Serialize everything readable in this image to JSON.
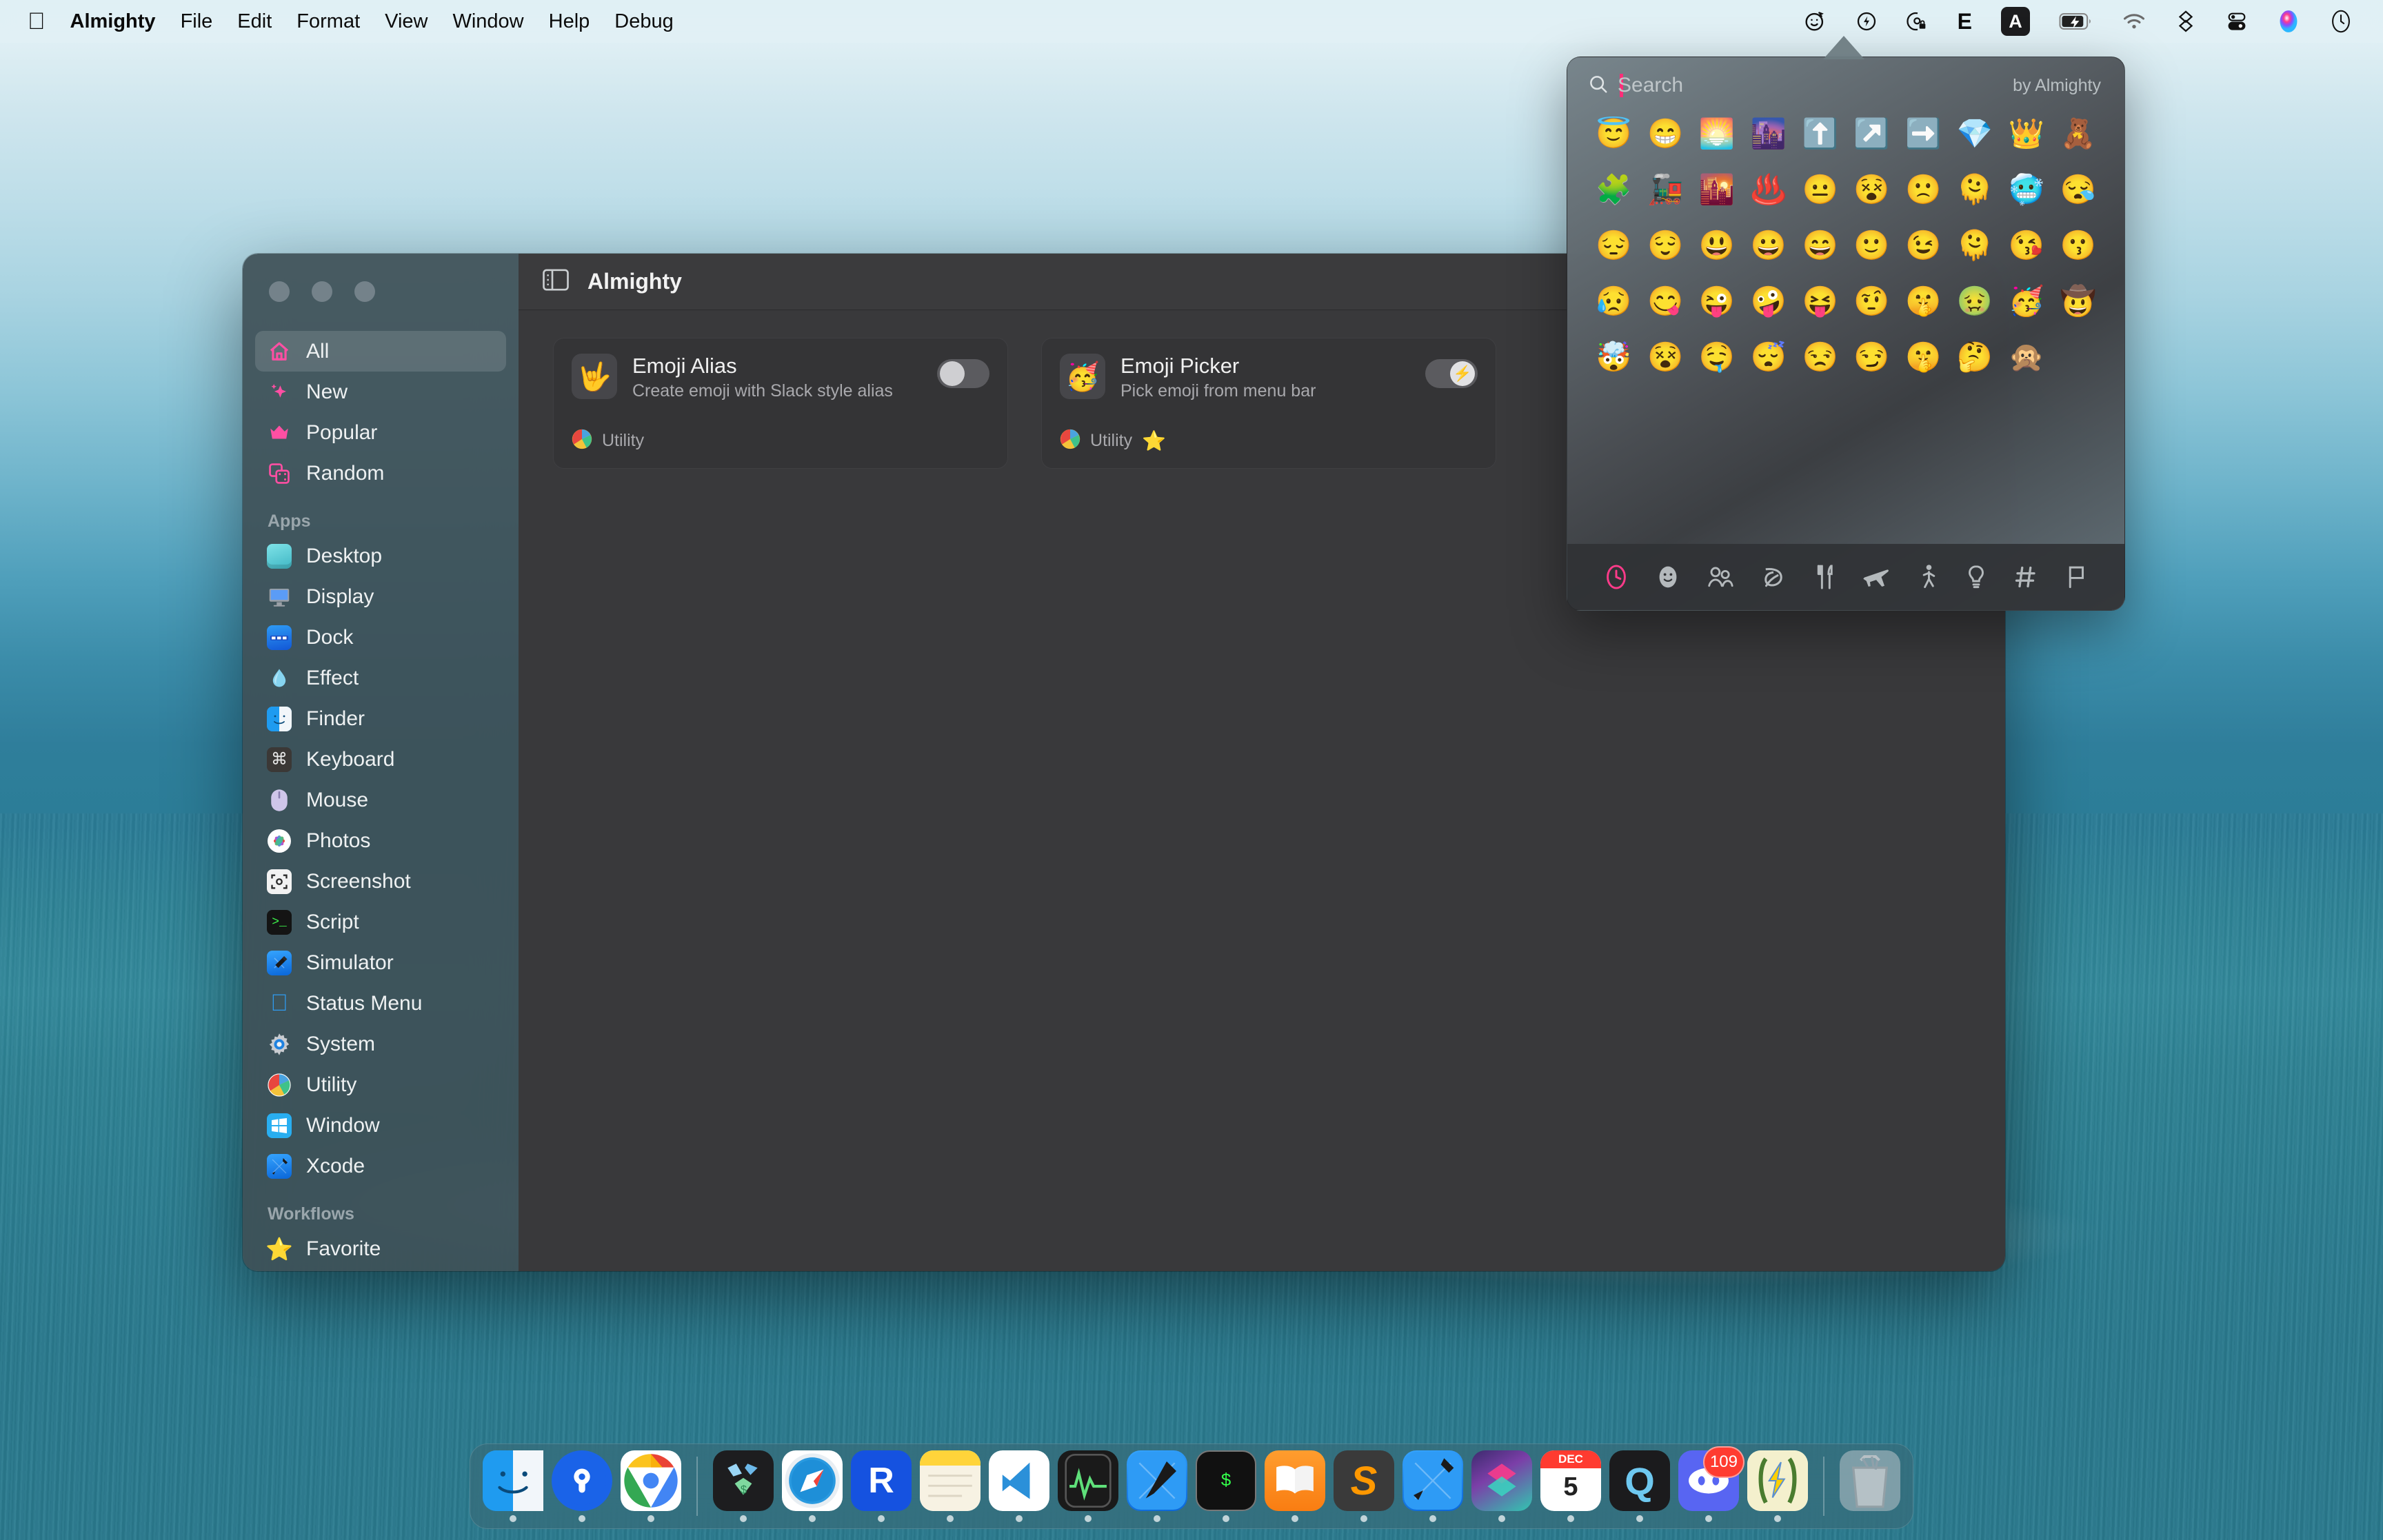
{
  "menubar": {
    "apple_icon": "apple-icon",
    "items": [
      {
        "label": "Almighty",
        "bold": true
      },
      {
        "label": "File",
        "bold": false
      },
      {
        "label": "Edit",
        "bold": false
      },
      {
        "label": "Format",
        "bold": false
      },
      {
        "label": "View",
        "bold": false
      },
      {
        "label": "Window",
        "bold": false
      },
      {
        "label": "Help",
        "bold": false
      },
      {
        "label": "Debug",
        "bold": false
      }
    ],
    "status_icons": [
      "emoji-smiley-icon",
      "bolt-circle-icon",
      "lock-circle-icon",
      "letter-e-icon",
      "input-source-a-icon",
      "battery-charging-icon",
      "wifi-icon",
      "dropbox-icon",
      "control-center-icon",
      "siri-icon",
      "clock-icon"
    ],
    "status_text": {
      "e_label": "E",
      "a_label": "A"
    }
  },
  "window": {
    "toolbar": {
      "sidebar_toggle_icon": "sidebar-toggle-icon",
      "title": "Almighty",
      "search_icon": "search-icon"
    },
    "sidebar": {
      "top_items": [
        {
          "label": "All",
          "icon": "home-icon",
          "glyph": "⌂",
          "active": true
        },
        {
          "label": "New",
          "icon": "sparkles-icon",
          "glyph": "✦",
          "active": false
        },
        {
          "label": "Popular",
          "icon": "crown-icon",
          "glyph": "♛",
          "active": false
        },
        {
          "label": "Random",
          "icon": "dice-icon",
          "glyph": "⚇",
          "active": false
        }
      ],
      "apps_header": "Apps",
      "apps": [
        {
          "label": "Desktop",
          "icon": "desktop-icon"
        },
        {
          "label": "Display",
          "icon": "display-icon"
        },
        {
          "label": "Dock",
          "icon": "dock-icon"
        },
        {
          "label": "Effect",
          "icon": "water-drop-icon"
        },
        {
          "label": "Finder",
          "icon": "finder-icon"
        },
        {
          "label": "Keyboard",
          "icon": "command-key-icon"
        },
        {
          "label": "Mouse",
          "icon": "mouse-icon"
        },
        {
          "label": "Photos",
          "icon": "photos-icon"
        },
        {
          "label": "Screenshot",
          "icon": "screenshot-icon"
        },
        {
          "label": "Script",
          "icon": "terminal-script-icon"
        },
        {
          "label": "Simulator",
          "icon": "simulator-icon"
        },
        {
          "label": "Status Menu",
          "icon": "apple-logo-icon"
        },
        {
          "label": "System",
          "icon": "gear-icon"
        },
        {
          "label": "Utility",
          "icon": "beach-ball-icon"
        },
        {
          "label": "Window",
          "icon": "windows-logo-icon"
        },
        {
          "label": "Xcode",
          "icon": "xcode-hammer-icon"
        }
      ],
      "workflows_header": "Workflows",
      "workflows": [
        {
          "label": "Favorite",
          "icon": "star-icon",
          "glyph": "⭐"
        }
      ]
    },
    "cards": [
      {
        "icon": "love-you-gesture-icon",
        "glyph": "🤟",
        "title": "Emoji Alias",
        "subtitle": "Create emoji with Slack style alias",
        "toggle_on": false,
        "toggle_glyph": "",
        "category": "Utility",
        "category_icon": "beach-ball-icon",
        "favorite": false,
        "favorite_glyph": ""
      },
      {
        "icon": "partying-face-icon",
        "glyph": "🥳",
        "title": "Emoji Picker",
        "subtitle": "Pick emoji from menu bar",
        "toggle_on": true,
        "toggle_glyph": "⚡",
        "category": "Utility",
        "category_icon": "beach-ball-icon",
        "favorite": true,
        "favorite_glyph": "⭐"
      }
    ]
  },
  "emoji_popup": {
    "search_icon": "search-icon",
    "search_value": "",
    "search_placeholder": "Search",
    "branding": "by Almighty",
    "caret_color": "#ff2d78",
    "accent_color": "#ff3b8a",
    "emojis": [
      "😇",
      "😁",
      "🌅",
      "🌆",
      "⬆️",
      "↗️",
      "➡️",
      "💎",
      "👑",
      "🧸",
      "🧩",
      "🚂",
      "🌇",
      "♨️",
      "😐",
      "😵",
      "🙁",
      "🫠",
      "🥶",
      "😪",
      "😔",
      "😌",
      "😃",
      "😀",
      "😄",
      "🙂",
      "😉",
      "🫠",
      "😘",
      "😗",
      "😥",
      "😋",
      "😜",
      "🤪",
      "😝",
      "🤨",
      "🤫",
      "🤢",
      "🥳",
      "🤠",
      "🤯",
      "😵",
      "🤤",
      "😴",
      "😒",
      "😏",
      "🤫",
      "🤔",
      "🙊"
    ],
    "categories": [
      {
        "name": "recent-clock-icon",
        "active": true
      },
      {
        "name": "smileys-icon",
        "active": false
      },
      {
        "name": "people-icon",
        "active": false
      },
      {
        "name": "nature-leaf-icon",
        "active": false
      },
      {
        "name": "food-icon",
        "active": false
      },
      {
        "name": "travel-plane-icon",
        "active": false
      },
      {
        "name": "activity-walk-icon",
        "active": false
      },
      {
        "name": "objects-bulb-icon",
        "active": false
      },
      {
        "name": "symbols-hash-icon",
        "active": false
      },
      {
        "name": "flags-icon",
        "active": false
      }
    ]
  },
  "dock": {
    "left_apps": [
      {
        "name": "finder",
        "label": "Finder",
        "glyph": "",
        "running": true
      },
      {
        "name": "1password",
        "label": "1Password",
        "glyph": "",
        "running": true
      },
      {
        "name": "chrome",
        "label": "Google Chrome",
        "glyph": "",
        "running": true
      }
    ],
    "main_apps": [
      {
        "name": "sketch",
        "label": "Sketch",
        "glyph": "",
        "running": true
      },
      {
        "name": "safari",
        "label": "Safari",
        "glyph": "",
        "running": true
      },
      {
        "name": "rectangle",
        "label": "Rectangle",
        "glyph": "R",
        "running": true
      },
      {
        "name": "notes",
        "label": "Notes",
        "glyph": "",
        "running": true
      },
      {
        "name": "vscode",
        "label": "Visual Studio Code",
        "glyph": "",
        "running": true
      },
      {
        "name": "activity-monitor",
        "label": "Activity Monitor",
        "glyph": "",
        "running": true
      },
      {
        "name": "xcode-beta",
        "label": "Xcode Beta",
        "glyph": "",
        "running": true
      },
      {
        "name": "terminal",
        "label": "Terminal",
        "glyph": "$",
        "running": true
      },
      {
        "name": "books",
        "label": "Books",
        "glyph": "",
        "running": true
      },
      {
        "name": "sublime",
        "label": "Sublime Text",
        "glyph": "S",
        "running": true
      },
      {
        "name": "xcode",
        "label": "Xcode",
        "glyph": "",
        "running": true
      },
      {
        "name": "shortcuts",
        "label": "Shortcuts",
        "glyph": "",
        "running": true
      },
      {
        "name": "calendar",
        "label": "Calendar",
        "glyph": "5",
        "month": "DEC",
        "running": true
      },
      {
        "name": "quicktime",
        "label": "QuickTime Player",
        "glyph": "Q",
        "running": true
      },
      {
        "name": "discord",
        "label": "Discord",
        "glyph": "",
        "badge": "109",
        "running": true
      },
      {
        "name": "almighty",
        "label": "Almighty",
        "glyph": "⚡",
        "running": true
      }
    ],
    "trash": {
      "name": "trash",
      "label": "Trash",
      "glyph": "",
      "running": false
    }
  }
}
